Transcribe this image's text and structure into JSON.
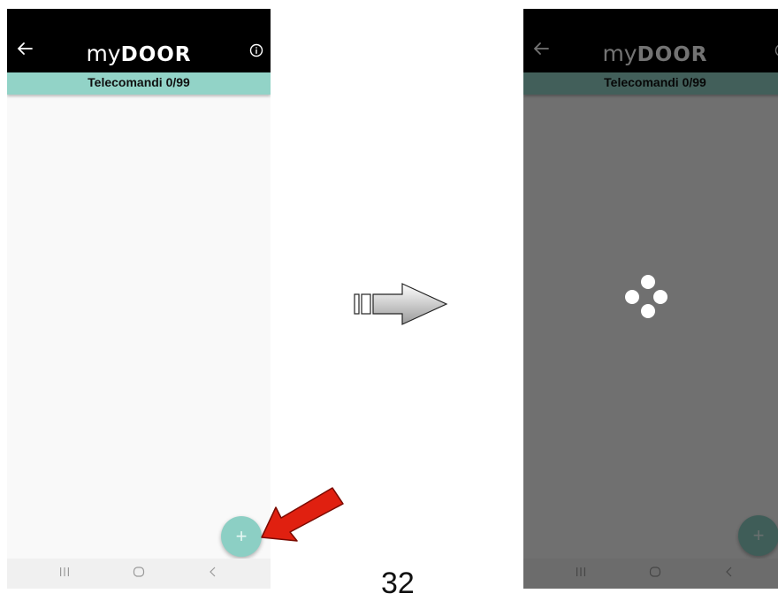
{
  "app": {
    "title_prefix": "my",
    "title_brand": "DOOR",
    "subtitle": "Telecomandi 0/99",
    "fab_label": "+"
  },
  "screens": [
    {
      "state": "empty-list"
    },
    {
      "state": "loading"
    }
  ],
  "icons": {
    "back": "arrow-left-icon",
    "info": "info-circle-icon",
    "add": "plus-icon",
    "spinner": "loading-spinner-icon",
    "nav_recents": "recents-icon",
    "nav_home": "home-icon",
    "nav_back": "chevron-left-icon",
    "flow": "right-arrow-icon",
    "pointer": "red-pointer-arrow-icon"
  },
  "colors": {
    "appbar": "#000000",
    "subbar": "#92d3c7",
    "fab": "#8ccfc4",
    "pointer_arrow": "#e02010",
    "overlay": "rgba(0,0,0,0.55)"
  },
  "page_number": "32"
}
